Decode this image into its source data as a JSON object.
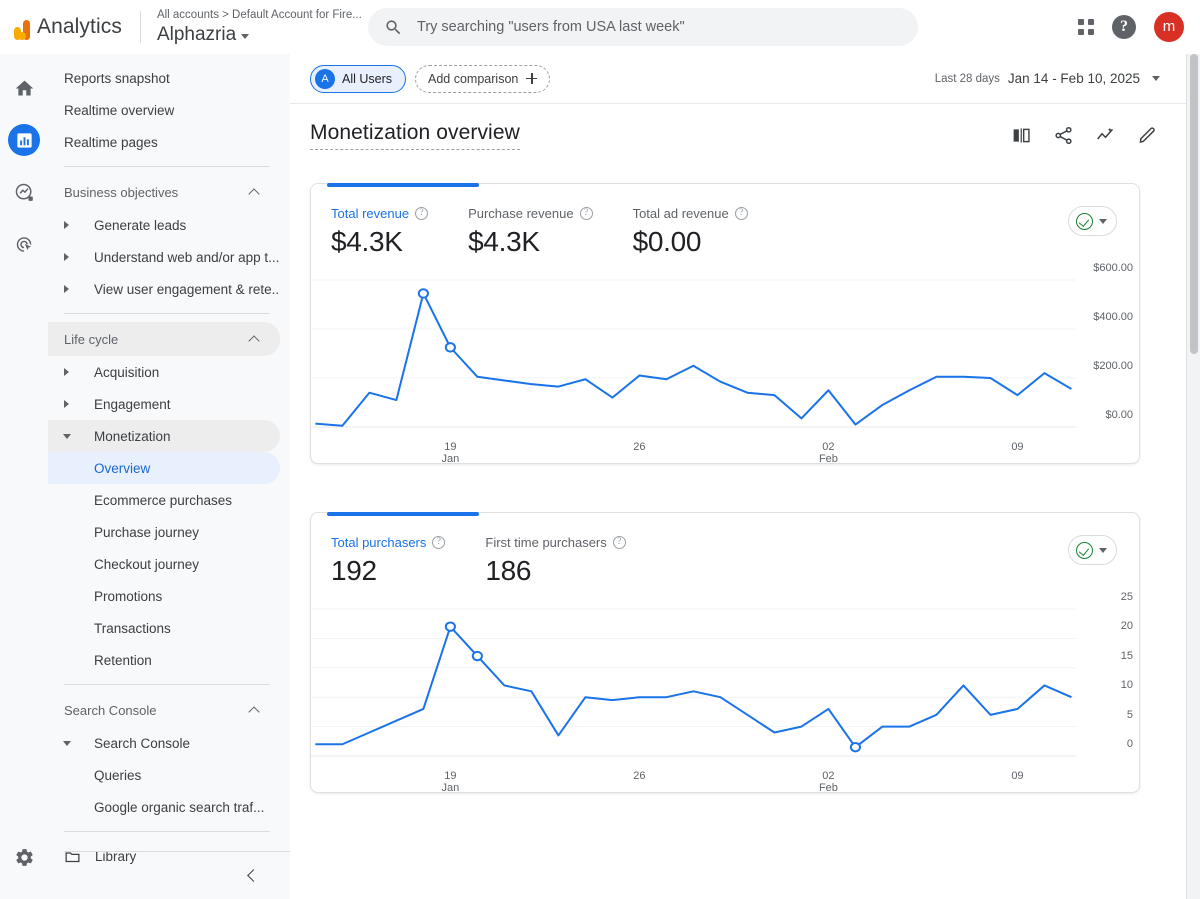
{
  "topbar": {
    "brand": "Analytics",
    "logo_icon": "analytics-logo-icon",
    "breadcrumb": "All accounts > Default Account for Fire...",
    "property": "Alphazria",
    "property_caret_icon": "chevron-down-icon",
    "search": {
      "icon": "search-icon",
      "placeholder": "Try searching \"users from USA last week\"",
      "value": ""
    },
    "apps_icon": "apps-grid-icon",
    "help_icon": "help-icon",
    "help_glyph": "?",
    "avatar_initial": "m",
    "avatar_color": "#d93025"
  },
  "rail": {
    "items": [
      {
        "icon": "home-icon",
        "name": "home",
        "active": false
      },
      {
        "icon": "reports-bar-chart-icon",
        "name": "reports",
        "active": true
      },
      {
        "icon": "explore-icon",
        "name": "explore",
        "active": false
      },
      {
        "icon": "advertising-target-icon",
        "name": "advertising",
        "active": false
      }
    ],
    "settings_icon": "gear-icon",
    "active_color": "#1a73e8"
  },
  "nav": {
    "top_items": [
      {
        "label": "Reports snapshot"
      },
      {
        "label": "Realtime overview"
      },
      {
        "label": "Realtime pages"
      }
    ],
    "sections": [
      {
        "title": "Business objectives",
        "collapse_icon": "chevron-up-icon",
        "items": [
          {
            "label": "Generate leads",
            "expander": "right"
          },
          {
            "label": "Understand web and/or app t...",
            "expander": "right"
          },
          {
            "label": "View user engagement & rete...",
            "expander": "right"
          }
        ]
      },
      {
        "title": "Life cycle",
        "collapse_icon": "chevron-up-icon",
        "items": [
          {
            "label": "Acquisition",
            "expander": "right"
          },
          {
            "label": "Engagement",
            "expander": "right"
          },
          {
            "label": "Monetization",
            "expander": "down",
            "highlighted": true
          },
          {
            "label": "Overview",
            "child": true,
            "selected": true
          },
          {
            "label": "Ecommerce purchases",
            "child": true
          },
          {
            "label": "Purchase journey",
            "child": true
          },
          {
            "label": "Checkout journey",
            "child": true
          },
          {
            "label": "Promotions",
            "child": true
          },
          {
            "label": "Transactions",
            "child": true
          },
          {
            "label": "Retention"
          }
        ]
      },
      {
        "title": "Search Console",
        "collapse_icon": "chevron-up-icon",
        "items": [
          {
            "label": "Search Console",
            "expander": "down"
          },
          {
            "label": "Queries",
            "child": true
          },
          {
            "label": "Google organic search traf...",
            "child": true
          }
        ]
      }
    ],
    "library": {
      "label": "Library",
      "icon": "folder-icon"
    },
    "collapse_icon": "chevron-left-icon"
  },
  "main": {
    "audience_chip": {
      "initial": "A",
      "label": "All Users"
    },
    "add_comparison": {
      "label": "Add comparison",
      "icon": "plus-icon"
    },
    "date_range": {
      "preset": "Last 28 days",
      "range": "Jan 14 - Feb 10, 2025",
      "caret_icon": "chevron-down-icon"
    },
    "page_title": "Monetization overview",
    "title_actions": [
      {
        "icon": "compare-panels-icon",
        "name": "compare"
      },
      {
        "icon": "share-icon",
        "name": "share"
      },
      {
        "icon": "insights-icon",
        "name": "insights"
      },
      {
        "icon": "pencil-edit-icon",
        "name": "edit"
      }
    ],
    "accent_color": "#1a73e8"
  },
  "cards": [
    {
      "name": "revenue-card",
      "metrics": [
        {
          "label": "Total revenue",
          "value": "$4.3K",
          "primary": true,
          "info_icon": "help-circle-icon"
        },
        {
          "label": "Purchase revenue",
          "value": "$4.3K",
          "primary": false,
          "info_icon": "help-circle-icon"
        },
        {
          "label": "Total ad revenue",
          "value": "$0.00",
          "primary": false,
          "info_icon": "help-circle-icon"
        }
      ],
      "control": {
        "status_icon": "check-circle-icon",
        "caret_icon": "chevron-down-icon",
        "status_color": "#188038"
      }
    },
    {
      "name": "purchasers-card",
      "metrics": [
        {
          "label": "Total purchasers",
          "value": "192",
          "primary": true,
          "info_icon": "help-circle-icon"
        },
        {
          "label": "First time purchasers",
          "value": "186",
          "primary": false,
          "info_icon": "help-circle-icon"
        }
      ],
      "control": {
        "status_icon": "check-circle-icon",
        "caret_icon": "chevron-down-icon",
        "status_color": "#188038"
      }
    }
  ],
  "chart_data": [
    {
      "type": "line",
      "name": "total-revenue-chart",
      "title": "Total revenue",
      "xlabel": "",
      "ylabel": "",
      "ylim": [
        0,
        600
      ],
      "yticks": [
        0,
        200,
        400,
        600
      ],
      "ytick_labels": [
        "$0.00",
        "$200.00",
        "$400.00",
        "$600.00"
      ],
      "grid": true,
      "line_color": "#1a73e8",
      "x": [
        "Jan 14",
        "Jan 15",
        "Jan 16",
        "Jan 17",
        "Jan 18",
        "Jan 19",
        "Jan 20",
        "Jan 21",
        "Jan 22",
        "Jan 23",
        "Jan 24",
        "Jan 25",
        "Jan 26",
        "Jan 27",
        "Jan 28",
        "Jan 29",
        "Jan 30",
        "Jan 31",
        "Feb 01",
        "Feb 02",
        "Feb 03",
        "Feb 04",
        "Feb 05",
        "Feb 06",
        "Feb 07",
        "Feb 08",
        "Feb 09",
        "Feb 10"
      ],
      "xtick_labels": [
        {
          "day": "19",
          "month": "Jan",
          "index": 5
        },
        {
          "day": "26",
          "month": "",
          "index": 12
        },
        {
          "day": "02",
          "month": "Feb",
          "index": 19
        },
        {
          "day": "09",
          "month": "",
          "index": 26
        }
      ],
      "values": [
        14,
        5,
        140,
        110,
        545,
        325,
        205,
        190,
        175,
        165,
        195,
        120,
        210,
        195,
        250,
        185,
        140,
        130,
        35,
        150,
        10,
        90,
        150,
        205,
        205,
        200,
        130,
        220,
        155
      ],
      "markers": [
        {
          "index": 4,
          "value": 545
        },
        {
          "index": 5,
          "value": 325
        }
      ]
    },
    {
      "type": "line",
      "name": "total-purchasers-chart",
      "title": "Total purchasers",
      "xlabel": "",
      "ylabel": "",
      "ylim": [
        0,
        25
      ],
      "yticks": [
        0,
        5,
        10,
        15,
        20,
        25
      ],
      "ytick_labels": [
        "0",
        "5",
        "10",
        "15",
        "20",
        "25"
      ],
      "grid": true,
      "line_color": "#1a73e8",
      "x": [
        "Jan 14",
        "Jan 15",
        "Jan 16",
        "Jan 17",
        "Jan 18",
        "Jan 19",
        "Jan 20",
        "Jan 21",
        "Jan 22",
        "Jan 23",
        "Jan 24",
        "Jan 25",
        "Jan 26",
        "Jan 27",
        "Jan 28",
        "Jan 29",
        "Jan 30",
        "Jan 31",
        "Feb 01",
        "Feb 02",
        "Feb 03",
        "Feb 04",
        "Feb 05",
        "Feb 06",
        "Feb 07",
        "Feb 08",
        "Feb 09",
        "Feb 10"
      ],
      "xtick_labels": [
        {
          "day": "19",
          "month": "Jan",
          "index": 5
        },
        {
          "day": "26",
          "month": "",
          "index": 12
        },
        {
          "day": "02",
          "month": "Feb",
          "index": 19
        },
        {
          "day": "09",
          "month": "",
          "index": 26
        }
      ],
      "values": [
        2,
        2,
        4,
        6,
        8,
        22,
        17,
        12,
        11,
        3.5,
        10,
        9.5,
        10,
        10,
        11,
        10,
        7,
        4,
        5,
        8,
        1.5,
        5,
        5,
        7,
        12,
        7,
        8,
        12,
        10
      ],
      "markers": [
        {
          "index": 5,
          "value": 22
        },
        {
          "index": 6,
          "value": 17
        },
        {
          "index": 20,
          "value": 1.5
        }
      ]
    }
  ]
}
